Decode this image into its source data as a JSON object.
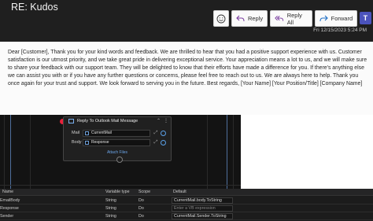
{
  "email": {
    "subject": "RE: Kudos",
    "datetime": "Fri 12/15/2023 5:24 PM",
    "toolbar": {
      "reply": "Reply",
      "reply_all": "Reply All",
      "forward": "Forward"
    },
    "body": "Dear [Customer], Thank you for your kind words and feedback. We are thrilled to hear that you had a positive support experience with us. Customer satisfaction is our utmost priority, and we take great pride in delivering exceptional service. Your appreciation means a lot to us, and we will make sure to share your feedback with our support team. They will be delighted to know that their efforts have made a difference for you. If there's anything else we can assist you with or if you have any further questions or concerns, please feel free to reach out to us. We are always here to help. Thank you once again for your trust and support. We look forward to serving you in the future. Best regards, [Your Name] [Your Position/Title] [Company Name]"
  },
  "activity": {
    "title": "Reply To Outlook Mail Message",
    "mail_label": "Mail",
    "mail_value": "CurrentMail",
    "body_label": "Body",
    "body_value": "Response",
    "attach_label": "Attach Files"
  },
  "variables": {
    "headers": {
      "name": "Name",
      "type": "Variable type",
      "scope": "Scope",
      "default": "Default"
    },
    "rows": [
      {
        "name": "EmailBody",
        "type": "String",
        "scope": "Do",
        "default": "CurrentMail.body.ToString"
      },
      {
        "name": "Response",
        "type": "String",
        "scope": "Do",
        "default": "Enter a VB expression"
      },
      {
        "name": "Sender",
        "type": "String",
        "scope": "Do",
        "default": "CurrentMail.Sender.ToString"
      }
    ]
  },
  "colors": {
    "outlook_header": "#1f1f1f",
    "canvas_bg": "#131313",
    "breakpoint": "#e8223b",
    "teams": "#4b53bc"
  }
}
